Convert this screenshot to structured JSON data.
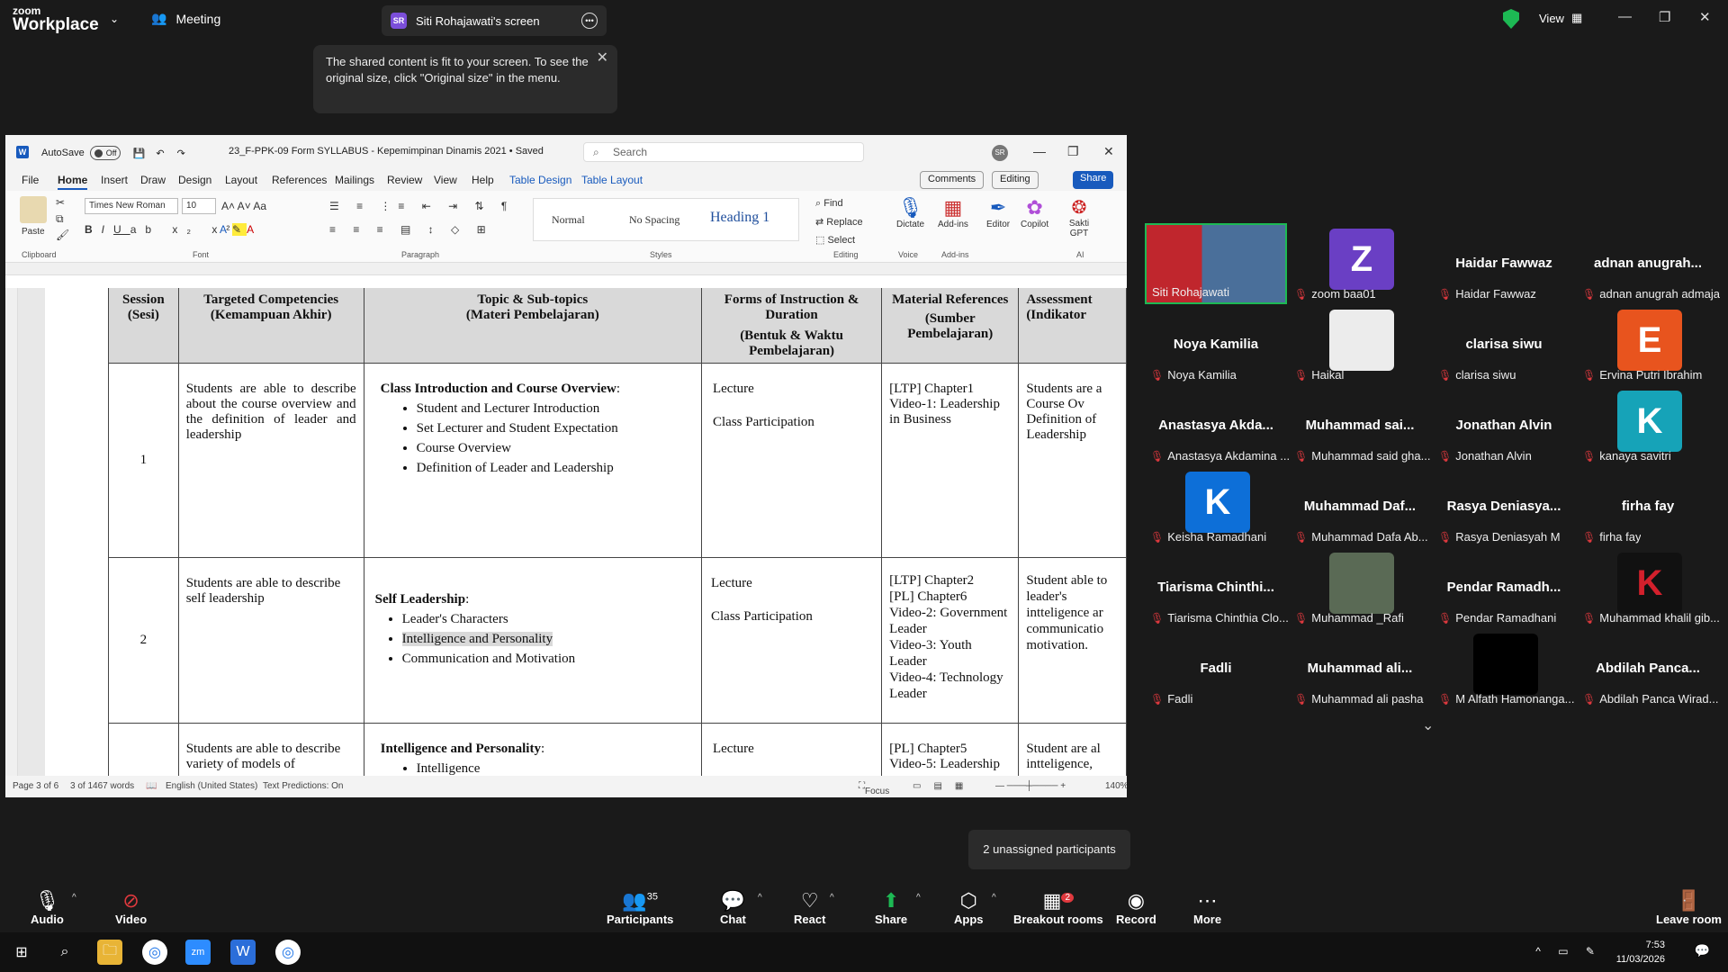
{
  "zoom": {
    "brand_line1": "zoom",
    "brand_line2": "Workplace",
    "tab_meeting": "Meeting",
    "tab_share": "Siti Rohajawati's screen",
    "share_initials": "SR",
    "view_label": "View",
    "notice": "The shared content is fit to your screen. To see the original size, click \"Original size\" in the menu."
  },
  "word": {
    "autosave": "AutoSave",
    "autosave_state": "Off",
    "doc_title": "23_F-PPK-09 Form SYLLABUS - Kepemimpinan Dinamis 2021 • Saved",
    "search_placeholder": "Search",
    "user_initials": "SR",
    "menu": [
      "File",
      "Home",
      "Insert",
      "Draw",
      "Design",
      "Layout",
      "References",
      "Mailings",
      "Review",
      "View",
      "Help",
      "Table Design",
      "Table Layout"
    ],
    "comments": "Comments",
    "editing": "Editing",
    "share": "Share",
    "ribbon": {
      "paste": "Paste",
      "font_name": "Times New Roman",
      "font_size": "10",
      "styles": [
        "Normal",
        "No Spacing",
        "Heading 1"
      ],
      "find": "Find",
      "replace": "Replace",
      "select": "Select",
      "dictate": "Dictate",
      "addins": "Add-ins",
      "editor": "Editor",
      "copilot": "Copilot",
      "sakti": "Sakti GPT",
      "groups": [
        "Clipboard",
        "Font",
        "Paragraph",
        "Styles",
        "Editing",
        "Voice",
        "Add-ins",
        "AI"
      ]
    },
    "table": {
      "headers": [
        [
          "Session",
          "(Sesi)"
        ],
        [
          "Targeted Competencies",
          "(Kemampuan Akhir)"
        ],
        [
          "Topic & Sub-topics",
          "(Materi Pembelajaran)"
        ],
        [
          "Forms of Instruction & Duration",
          "(Bentuk & Waktu Pembelajaran)"
        ],
        [
          "Material References",
          "(Sumber Pembelajaran)"
        ],
        [
          "Assessment",
          "(Indikator"
        ]
      ],
      "rows": [
        {
          "session": "1",
          "competency": "Students are able to describe about the course overview and the definition of leader and leadership",
          "topic_title": "Class Introduction and Course Overview",
          "topics": [
            "Student and Lecturer Introduction",
            "Set Lecturer and Student Expectation",
            "Course Overview",
            "Definition of Leader and Leadership"
          ],
          "forms": [
            "Lecture",
            "Class Participation"
          ],
          "refs": [
            "[LTP] Chapter1",
            "Video-1: Leadership in Business"
          ],
          "assessment": "Students are a Course Ov Definition of Leadership"
        },
        {
          "session": "2",
          "competency": "Students are able to describe self leadership",
          "topic_title": "Self Leadership",
          "topics": [
            "Leader's Characters",
            "Intelligence and Personality",
            "Communication and Motivation"
          ],
          "forms": [
            "Lecture",
            "Class Participation"
          ],
          "refs": [
            "[LTP] Chapter2",
            "[PL] Chapter6",
            "Video-2: Government Leader",
            "Video-3: Youth Leader",
            "Video-4: Technology Leader"
          ],
          "assessment": "Student able to leader's intteligence ar communicatio motivation."
        },
        {
          "session": "",
          "competency": "Students are able to describe variety of models of",
          "topic_title": "Intelligence and Personality",
          "topics": [
            "Intelligence"
          ],
          "forms": [
            "Lecture"
          ],
          "refs": [
            "[PL] Chapter5",
            "Video-5: Leadership"
          ],
          "assessment": "Student are al intteligence,"
        }
      ]
    },
    "status": {
      "page": "Page 3 of 6",
      "words": "3 of 1467 words",
      "language": "English (United States)",
      "predictions": "Text Predictions: On",
      "focus": "Focus",
      "zoom": "140%"
    }
  },
  "participants": [
    {
      "name": "Siti Rohajawati",
      "big": "",
      "avatar": "video",
      "color": "#c0262d"
    },
    {
      "name": "zoom baa01",
      "big": "",
      "avatar": "Z",
      "color": "#6a3fc4"
    },
    {
      "name": "Haidar Fawwaz",
      "big": "Haidar Fawwaz",
      "avatar": "",
      "color": ""
    },
    {
      "name": "adnan anugrah admaja",
      "big": "adnan anugrah...",
      "avatar": "",
      "color": ""
    },
    {
      "name": "Noya Kamilia",
      "big": "Noya Kamilia",
      "avatar": "",
      "color": ""
    },
    {
      "name": "Haikal",
      "big": "",
      "avatar": "sketch",
      "color": "#ececec"
    },
    {
      "name": "clarisa siwu",
      "big": "clarisa siwu",
      "avatar": "",
      "color": ""
    },
    {
      "name": "Ervina Putri Ibrahim",
      "big": "",
      "avatar": "E",
      "color": "#e8541e"
    },
    {
      "name": "Anastasya Akdamina ...",
      "big": "Anastasya Akda...",
      "avatar": "",
      "color": ""
    },
    {
      "name": "Muhammad said gha...",
      "big": "Muhammad sai...",
      "avatar": "",
      "color": ""
    },
    {
      "name": "Jonathan Alvin",
      "big": "Jonathan Alvin",
      "avatar": "",
      "color": ""
    },
    {
      "name": "kanaya savitri",
      "big": "",
      "avatar": "K",
      "color": "#16a3b8"
    },
    {
      "name": "Keisha Ramadhani",
      "big": "",
      "avatar": "K",
      "color": "#0d6fd8"
    },
    {
      "name": "Muhammad Dafa Ab...",
      "big": "Muhammad Daf...",
      "avatar": "",
      "color": ""
    },
    {
      "name": "Rasya Deniasyah M",
      "big": "Rasya Deniasya...",
      "avatar": "",
      "color": ""
    },
    {
      "name": "firha fay",
      "big": "firha fay",
      "avatar": "",
      "color": ""
    },
    {
      "name": "Tiarisma Chinthia Clo...",
      "big": "Tiarisma Chinthi...",
      "avatar": "",
      "color": ""
    },
    {
      "name": "Muhammad _Rafi",
      "big": "",
      "avatar": "photo",
      "color": "#5a6a55"
    },
    {
      "name": "Pendar Ramadhani",
      "big": "Pendar Ramadh...",
      "avatar": "",
      "color": ""
    },
    {
      "name": "Muhammad khalil gib...",
      "big": "",
      "avatar": "K",
      "color": "#111111"
    },
    {
      "name": "Fadli",
      "big": "Fadli",
      "avatar": "",
      "color": ""
    },
    {
      "name": "Muhammad ali pasha",
      "big": "Muhammad ali...",
      "avatar": "",
      "color": ""
    },
    {
      "name": "M Alfath Hamonanga...",
      "big": "",
      "avatar": "black",
      "color": "#000000"
    },
    {
      "name": "Abdilah Panca Wirad...",
      "big": "Abdilah Panca...",
      "avatar": "",
      "color": ""
    }
  ],
  "unassigned": "2 unassigned participants",
  "toolbar": {
    "audio": "Audio",
    "video": "Video",
    "participants": "Participants",
    "participants_count": "35",
    "chat": "Chat",
    "react": "React",
    "share": "Share",
    "apps": "Apps",
    "breakout": "Breakout rooms",
    "breakout_badge": "2",
    "record": "Record",
    "more": "More",
    "leave": "Leave room"
  },
  "taskbar": {
    "time": "7:53",
    "date": "11/03/2026"
  }
}
